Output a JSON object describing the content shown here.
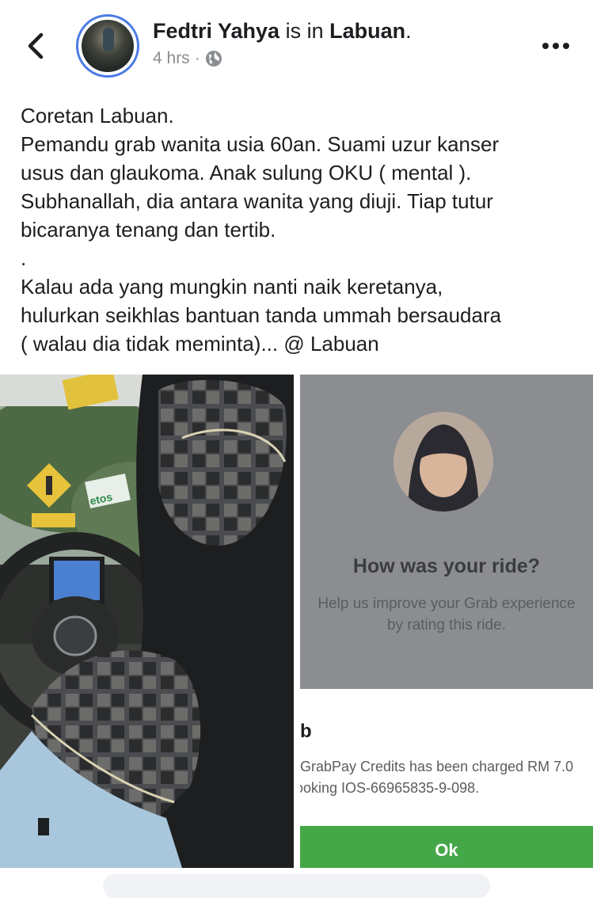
{
  "header": {
    "back_icon": "chevron-left-icon",
    "author": "Fedtri Yahya",
    "connector": "is in",
    "place": "Labuan",
    "period": ".",
    "time": "4 hrs",
    "separator": "·",
    "privacy_icon": "globe-icon",
    "more_icon": "more-horizontal-icon"
  },
  "post": {
    "lines": [
      "Coretan Labuan.",
      "Pemandu grab wanita usia 60an. Suami uzur kanser",
      "usus dan glaukoma. Anak sulung OKU ( mental ).",
      "Subhanallah, dia antara wanita yang diuji. Tiap tutur",
      "bicaranya tenang dan tertib.",
      ".",
      "Kalau ada yang mungkin nanti naik keretanya,",
      "hulurkan seikhlas bantuan tanda ummah bersaudara",
      "( walau dia tidak meminta)...  @ Labuan"
    ]
  },
  "photo_left": {
    "signs": [
      "etos"
    ]
  },
  "photo_right": {
    "rating_title": "How was your ride?",
    "rating_sub_1": "Help us improve your Grab experience",
    "rating_sub_2": "by rating this ride.",
    "sheet_title": "b",
    "sheet_line_1": "GrabPay Credits has been charged RM 7.0",
    "sheet_line_2": "ooking IOS-66965835-9-098.",
    "ok_label": "Ok"
  },
  "colors": {
    "accent_ring": "#4b7be5",
    "grab_green": "#44a849",
    "meta_gray": "#8a8d91"
  }
}
